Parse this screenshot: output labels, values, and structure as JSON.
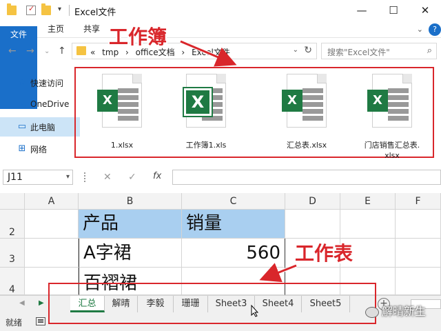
{
  "explorer": {
    "window_title": "Excel文件",
    "ribbon_tabs": [
      "文件",
      "主页",
      "共享"
    ],
    "breadcrumb": {
      "overflow": "«",
      "items": [
        "tmp",
        "office文档",
        "Excel文件"
      ],
      "separator": "›"
    },
    "search_placeholder": "搜索\"Excel文件\"",
    "nav_items": [
      {
        "label": "快速访问",
        "icon": "star-icon",
        "color": "#1a6fc9"
      },
      {
        "label": "OneDrive",
        "icon": "cloud-icon",
        "color": "#1a6fc9"
      },
      {
        "label": "此电脑",
        "icon": "computer-icon",
        "color": "#1a6fc9"
      },
      {
        "label": "网络",
        "icon": "network-icon",
        "color": "#1a6fc9"
      }
    ],
    "files": [
      {
        "name": "1.xlsx",
        "icon": "excel-xlsx-icon"
      },
      {
        "name": "工作簿1.xls",
        "icon": "excel-xls-icon"
      },
      {
        "name": "汇总表.xlsx",
        "icon": "excel-xlsx-icon"
      },
      {
        "name": "门店销售汇总表.",
        "name2": "xlsx",
        "icon": "excel-xlsx-icon"
      }
    ]
  },
  "excel": {
    "name_box": "J11",
    "columns": [
      "A",
      "B",
      "C",
      "D",
      "E",
      "F"
    ],
    "rows": [
      "2",
      "3",
      "4"
    ],
    "cells": {
      "B2": "产品",
      "C2": "销量",
      "B3": "A字裙",
      "C3": "560",
      "B4": "百褶裙"
    },
    "sheet_tabs": [
      "汇总",
      "解晴",
      "李毅",
      "珊珊",
      "Sheet3",
      "Sheet4",
      "Sheet5"
    ],
    "active_sheet": "汇总",
    "status": "就绪",
    "add_sheet_symbol": "+"
  },
  "annotations": {
    "workbook_label": "工作簿",
    "worksheet_label": "工作表",
    "color": "#d9262b"
  },
  "watermark": "解晴新生"
}
